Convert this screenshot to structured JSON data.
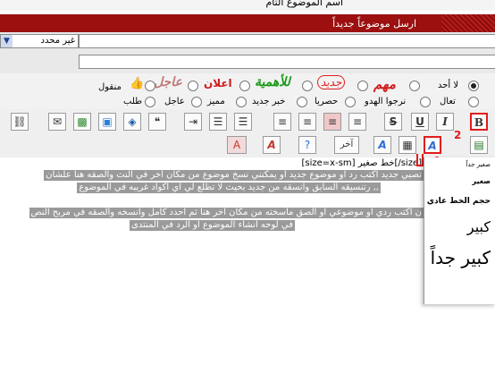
{
  "header": {
    "title_fragment": "اسم الموضوع التام",
    "title": "ارسل موضوعاً جديداً"
  },
  "form": {
    "select_value": "غير محدد",
    "select_arrow": "▼"
  },
  "post_icons": {
    "labels": [
      "لا أحد",
      "مهم",
      "جديد",
      "للأهمية",
      "اعلان",
      "عاجل",
      "منقول"
    ],
    "row2": [
      "تعال",
      "نرجوا الهدو",
      "حصريا",
      "خبر جديد",
      "مميز",
      "عاجل",
      "طلب"
    ]
  },
  "toolbar": {
    "bold": "B",
    "italic": "I",
    "underline": "U",
    "strike": "S",
    "other": "آخر",
    "font_a": "A"
  },
  "editor": {
    "size_tag": "[size=x-sm] خط صغير[/size]",
    "line1": "تصبي جديد اكتب رد او موضوع جديد او يمكنني  نسخ موضوع من مكان اخر في النث والصقه هنا علشان",
    "line2": "رتنسيقه السابق وانسقه من جديد بحيث لا تظلع لي اي اكواد غريبه في الموضوع ,,",
    "line3": "ن اكتب ردي او موضوعي او الصق ماسخته من مكان اخر هنا ثم احدد كامل وانسخه والصقه في مربح النص",
    "line4": "في لوحه انشاء الموضوع او الرد في المنتدى"
  },
  "size_menu": {
    "items": [
      "صغير جداً",
      "صغير",
      "حجم الخط عادي",
      "كبير",
      "كبير جداً"
    ]
  },
  "annotations": {
    "num1": "1",
    "num2": "2"
  }
}
